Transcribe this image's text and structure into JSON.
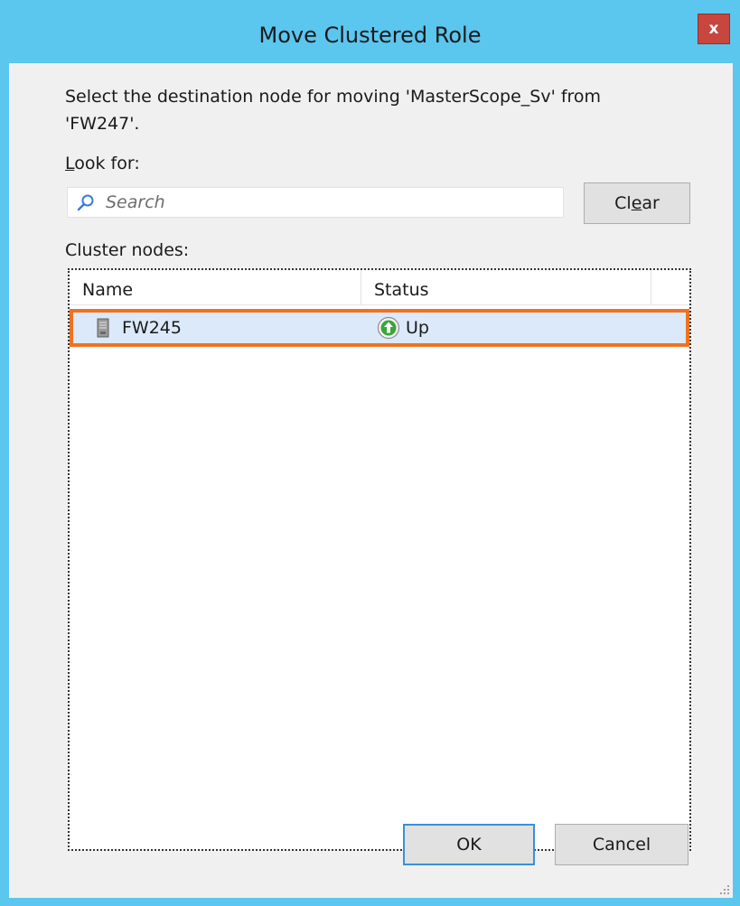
{
  "window": {
    "title": "Move Clustered Role",
    "close_glyph": "x"
  },
  "prompt": {
    "text": "Select the destination node for moving 'MasterScope_Sv' from 'FW247'."
  },
  "look_for": {
    "label_prefix": "",
    "label_accel": "L",
    "label_rest": "ook for:",
    "search_placeholder": "Search",
    "search_value": ""
  },
  "clear_button": {
    "label_before": "Cl",
    "label_accel": "e",
    "label_after": "ar"
  },
  "cluster_nodes": {
    "label": "Cluster nodes:",
    "columns": [
      "Name",
      "Status"
    ],
    "rows": [
      {
        "name": "FW245",
        "status": "Up",
        "node_icon": "server-icon",
        "status_icon": "status-up-icon"
      }
    ]
  },
  "buttons": {
    "ok": "OK",
    "cancel": "Cancel"
  },
  "colors": {
    "frame": "#5bc6ee",
    "close": "#c7463d",
    "selection": "#dbe9fb",
    "highlight": "#f07220",
    "status_up": "#3aa638"
  }
}
